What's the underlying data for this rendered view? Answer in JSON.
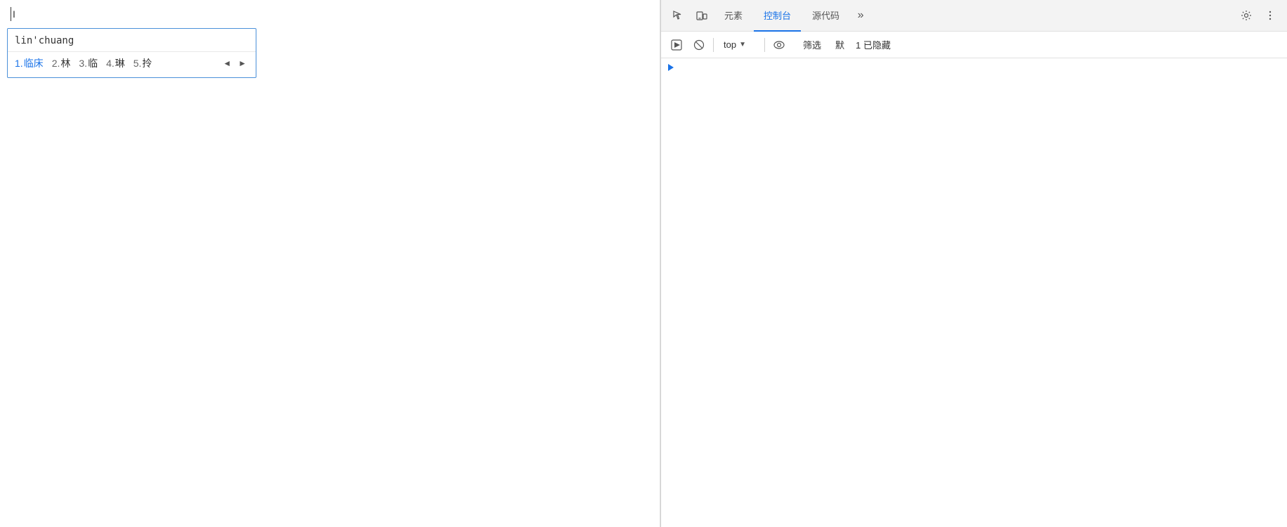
{
  "left_panel": {
    "cursor_symbol": "I",
    "ime_dropdown": {
      "input_text": "lin'chuang",
      "candidates": [
        {
          "num": "1.",
          "char": "临床",
          "highlight": true
        },
        {
          "num": "2.",
          "char": "林",
          "highlight": false
        },
        {
          "num": "3.",
          "char": "临",
          "highlight": false
        },
        {
          "num": "4.",
          "char": "琳",
          "highlight": false
        },
        {
          "num": "5.",
          "char": "拎",
          "highlight": false
        }
      ],
      "prev_arrow": "◄",
      "next_arrow": "►"
    }
  },
  "devtools": {
    "tabs": [
      {
        "label": "元素",
        "active": false
      },
      {
        "label": "控制台",
        "active": true
      },
      {
        "label": "源代码",
        "active": false
      }
    ],
    "overflow_btn": "»",
    "console_toolbar": {
      "play_btn_title": "run",
      "ban_btn_title": "clear",
      "context_label": "top",
      "context_arrow": "▼",
      "eye_btn_title": "watch",
      "filter_label": "筛选",
      "default_label": "默",
      "hidden_count": "1 已隐藏"
    },
    "expand_arrow": "▶"
  }
}
